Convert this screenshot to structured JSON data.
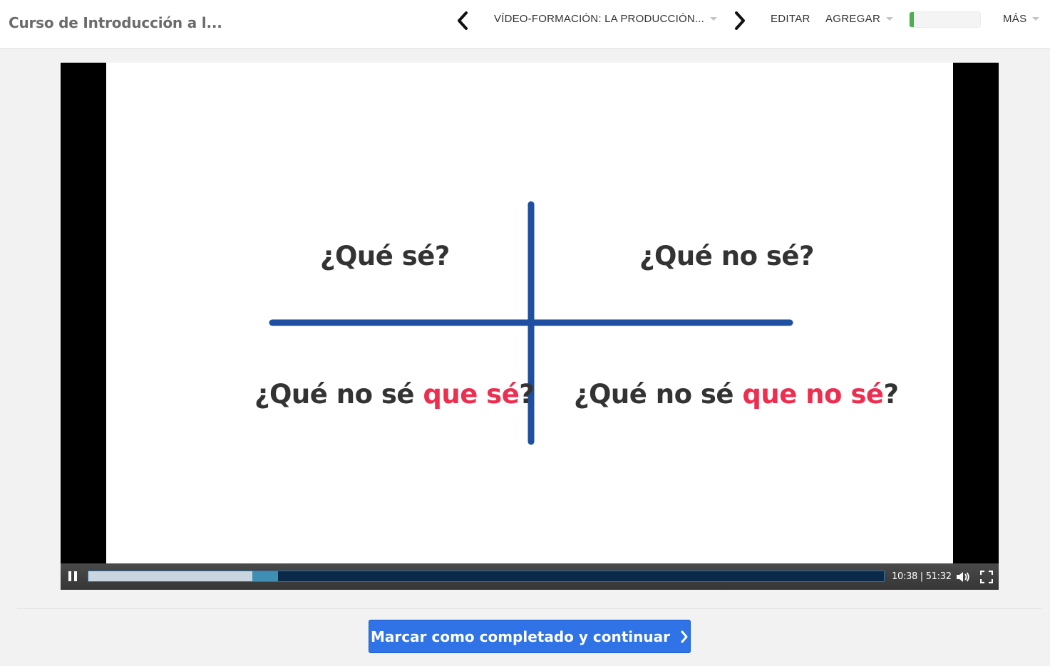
{
  "header": {
    "course_title": "Curso de Introducción a l...",
    "lesson_title": "VÍDEO-FORMACIÓN: LA PRODUCCIÓN...",
    "menu": {
      "edit_label": "EDITAR",
      "add_label": "AGREGAR",
      "more_label": "MÁS"
    },
    "progress": {
      "percent": 6,
      "color": "#4caf50"
    }
  },
  "slide": {
    "quadrants": {
      "top_left": {
        "text": "¿Qué sé?"
      },
      "top_right": {
        "text": "¿Qué no sé?"
      },
      "bottom_left": {
        "prefix": "¿Qué no sé ",
        "highlight": "que sé",
        "suffix": "?"
      },
      "bottom_right": {
        "prefix": "¿Qué no sé ",
        "highlight": "que no sé",
        "suffix": "?"
      }
    },
    "colors": {
      "axis": "#1f4fa0",
      "highlight": "#ee2e4e",
      "text": "#333333"
    }
  },
  "player": {
    "current_time": "10:38",
    "duration": "51:32",
    "time_display": "10:38 | 51:32",
    "played_fraction": 0.206,
    "buffered_fraction": 0.238,
    "state": "playing"
  },
  "cta": {
    "label": "Marcar como completado y continuar",
    "color": "#2f73e6"
  }
}
